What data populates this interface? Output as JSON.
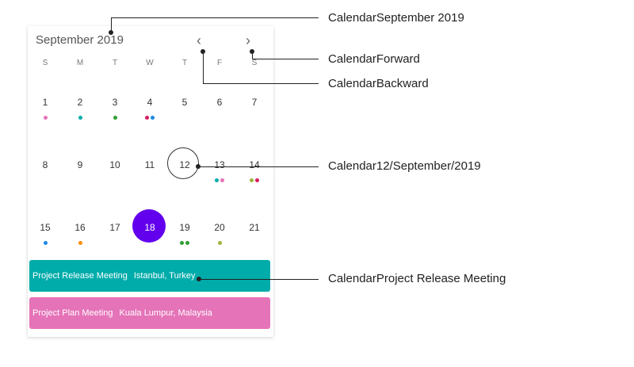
{
  "calendar": {
    "month_title": "September 2019",
    "nav_back_glyph": "‹",
    "nav_forward_glyph": "›",
    "weekdays": [
      "S",
      "M",
      "T",
      "W",
      "T",
      "F",
      "S"
    ],
    "days": [
      {
        "num": "1",
        "dots": [
          "#e573b8"
        ]
      },
      {
        "num": "2",
        "dots": [
          "#00acaa"
        ]
      },
      {
        "num": "3",
        "dots": [
          "#2e9e2e"
        ]
      },
      {
        "num": "4",
        "dots": [
          "#d81b60",
          "#1e88e5"
        ]
      },
      {
        "num": "5",
        "dots": []
      },
      {
        "num": "6",
        "dots": []
      },
      {
        "num": "7",
        "dots": []
      },
      {
        "num": "8",
        "dots": []
      },
      {
        "num": "9",
        "dots": []
      },
      {
        "num": "10",
        "dots": []
      },
      {
        "num": "11",
        "dots": []
      },
      {
        "num": "12",
        "dots": []
      },
      {
        "num": "13",
        "dots": [
          "#00acaa",
          "#e573b8"
        ]
      },
      {
        "num": "14",
        "dots": [
          "#9cb53a",
          "#d81b60"
        ]
      },
      {
        "num": "15",
        "dots": [
          "#1e88e5"
        ]
      },
      {
        "num": "16",
        "dots": [
          "#fb8c00"
        ]
      },
      {
        "num": "17",
        "dots": []
      },
      {
        "num": "18",
        "dots": [],
        "selected": true
      },
      {
        "num": "19",
        "dots": [
          "#2e9e2e",
          "#2e9e2e"
        ]
      },
      {
        "num": "20",
        "dots": [
          "#9cb53a"
        ]
      },
      {
        "num": "21",
        "dots": []
      }
    ],
    "today": "12",
    "selected": "18",
    "colors": {
      "selected": "#6200ee",
      "event1": "#00acaa",
      "event2": "#e573b8"
    }
  },
  "events": [
    {
      "title": "Project Release Meeting",
      "location": "Istanbul, Turkey"
    },
    {
      "title": "Project Plan Meeting",
      "location": "Kuala Lumpur, Malaysia"
    }
  ],
  "annotations": {
    "month": "CalendarSeptember 2019",
    "forward": "CalendarForward",
    "backward": "CalendarBackward",
    "date": "Calendar12/September/2019",
    "event": "CalendarProject Release Meeting"
  }
}
